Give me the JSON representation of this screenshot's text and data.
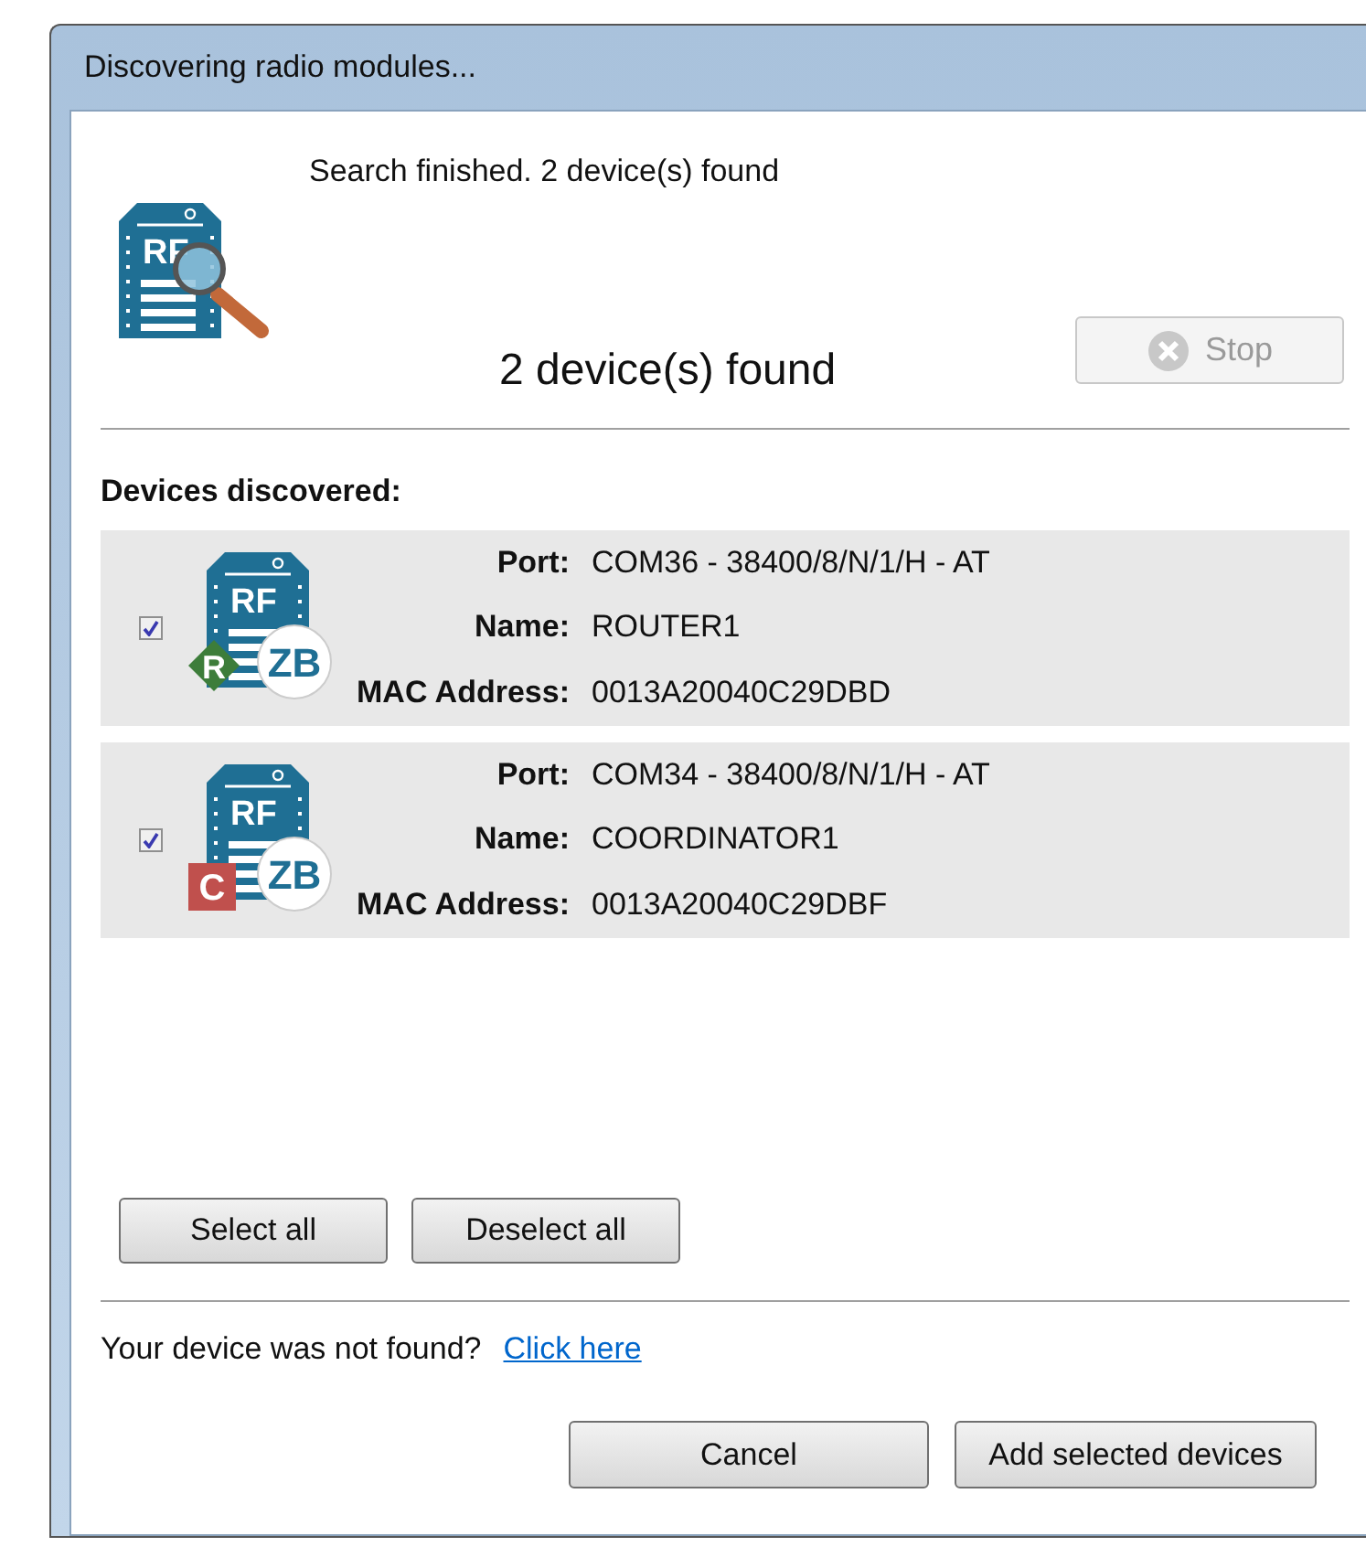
{
  "window": {
    "title": "Discovering radio modules..."
  },
  "header": {
    "icon_label": "RF",
    "status": "Search finished. 2 device(s) found",
    "count": "2 device(s) found",
    "stop_button": {
      "label": "Stop",
      "disabled": true
    }
  },
  "devices_heading": "Devices discovered:",
  "devices": [
    {
      "checked": true,
      "icon_label": "RF",
      "protocol": "ZB",
      "role": {
        "kind": "router",
        "letter": "R"
      },
      "fields": [
        {
          "label": "Port:",
          "value": "COM36 - 38400/8/N/1/H - AT"
        },
        {
          "label": "Name:",
          "value": "ROUTER1"
        },
        {
          "label": "MAC Address:",
          "value": "0013A20040C29DBD"
        }
      ]
    },
    {
      "checked": true,
      "icon_label": "RF",
      "protocol": "ZB",
      "role": {
        "kind": "coordinator",
        "letter": "C"
      },
      "fields": [
        {
          "label": "Port:",
          "value": "COM34 - 38400/8/N/1/H - AT"
        },
        {
          "label": "Name:",
          "value": "COORDINATOR1"
        },
        {
          "label": "MAC Address:",
          "value": "0013A20040C29DBF"
        }
      ]
    }
  ],
  "select_buttons": [
    "Select all",
    "Deselect all"
  ],
  "not_found": {
    "text": "Your device was not found?",
    "link": "Click here"
  },
  "buttons": [
    "Cancel",
    "Add selected devices"
  ]
}
